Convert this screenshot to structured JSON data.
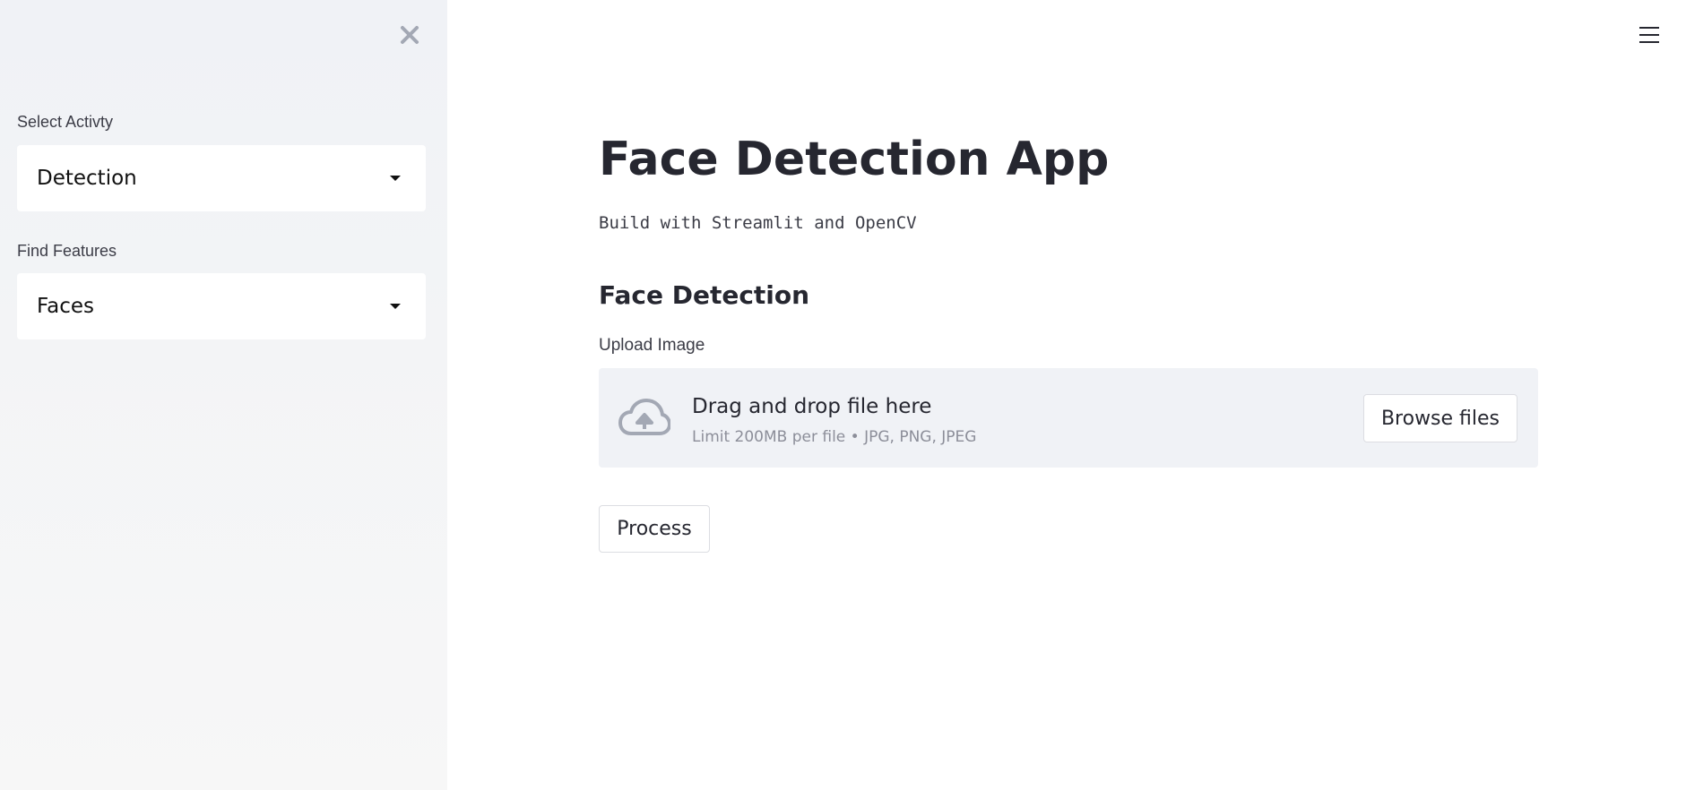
{
  "sidebar": {
    "close_icon": "close-icon",
    "activity": {
      "label": "Select Activty",
      "value": "Detection"
    },
    "features": {
      "label": "Find Features",
      "value": "Faces"
    }
  },
  "header": {
    "menu_icon": "hamburger-menu-icon"
  },
  "main": {
    "title": "Face Detection App",
    "subtitle": "Build with Streamlit and OpenCV",
    "section_heading": "Face Detection",
    "uploader": {
      "label": "Upload Image",
      "icon": "cloud-upload-icon",
      "instructions": "Drag and drop file here",
      "limits": "Limit 200MB per file • JPG, PNG, JPEG",
      "browse_label": "Browse files"
    },
    "process_label": "Process"
  },
  "colors": {
    "sidebar_bg": "#f0f2f6",
    "text": "#262730",
    "muted_text": "#8c8e99",
    "dropzone_bg": "#f0f2f6",
    "icon_gray": "#a3a8b4"
  }
}
